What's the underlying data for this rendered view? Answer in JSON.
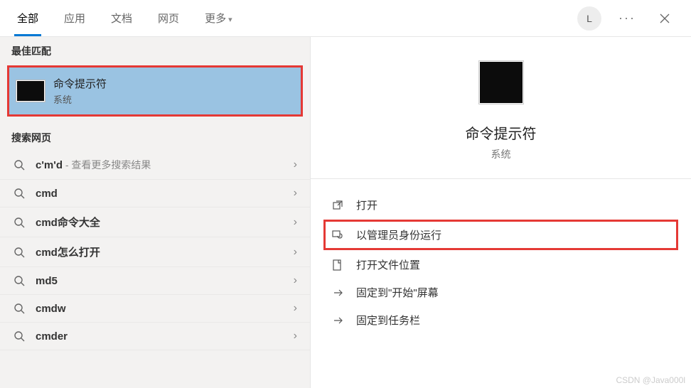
{
  "tabs": {
    "all": "全部",
    "apps": "应用",
    "docs": "文档",
    "web": "网页",
    "more": "更多"
  },
  "user_initial": "L",
  "sections": {
    "best_match": "最佳匹配",
    "search_web": "搜索网页"
  },
  "best": {
    "title": "命令提示符",
    "subtitle": "系统"
  },
  "web_results": [
    {
      "bold": "c'm'd",
      "hint": " - 查看更多搜索结果"
    },
    {
      "bold": "cmd",
      "hint": ""
    },
    {
      "bold": "cmd命令大全",
      "hint": ""
    },
    {
      "bold": "cmd怎么打开",
      "hint": ""
    },
    {
      "bold": "md5",
      "hint": ""
    },
    {
      "bold": "cmdw",
      "hint": ""
    },
    {
      "bold": "cmder",
      "hint": ""
    }
  ],
  "detail": {
    "title": "命令提示符",
    "subtitle": "系统"
  },
  "actions": {
    "open": "打开",
    "run_admin": "以管理员身份运行",
    "open_location": "打开文件位置",
    "pin_start": "固定到\"开始\"屏幕",
    "pin_taskbar": "固定到任务栏"
  },
  "watermark": "CSDN @Java000l"
}
